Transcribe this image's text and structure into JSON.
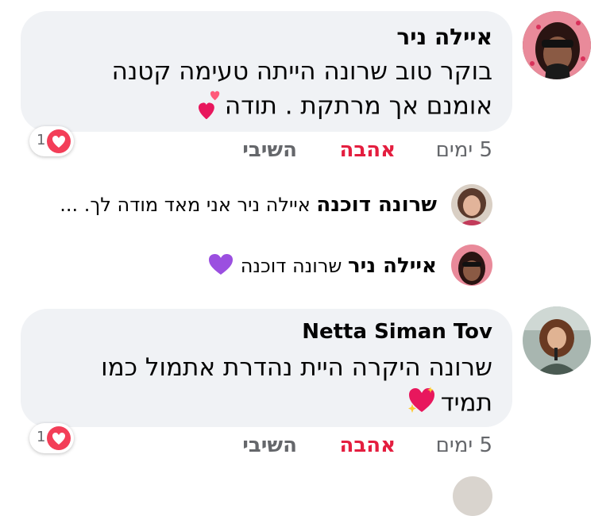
{
  "comments": [
    {
      "author": "איילה ניר",
      "lines": [
        "בוקר טוב שרונה הייתה טעימה קטנה",
        "אומנם אך מרתקת . תודה"
      ],
      "emoji_icon": "two-hearts-icon",
      "time": "5 ימים",
      "love_label": "אהבה",
      "reply_label": "השיבי",
      "reaction_count": "1",
      "reaction_icon": "love-reaction-icon"
    },
    {
      "author": "Netta Siman Tov",
      "lines": [
        "שרונה היקרה היית נהדרת אתמול כמו",
        "תמיד"
      ],
      "emoji_icon": "sparkling-heart-icon",
      "time": "5 ימים",
      "love_label": "אהבה",
      "reply_label": "השיבי",
      "reaction_count": "1",
      "reaction_icon": "love-reaction-icon"
    }
  ],
  "replies": [
    {
      "author": "שרונה דוכנה",
      "text": "איילה ניר אני מאד מודה לך. ..."
    },
    {
      "author": "איילה ניר",
      "text": "שרונה דוכנה",
      "emoji_icon": "purple-heart-icon"
    }
  ],
  "colors": {
    "bubble": "#f0f2f5",
    "love": "#e41e3f",
    "muted": "#65676b",
    "text": "#050505"
  }
}
